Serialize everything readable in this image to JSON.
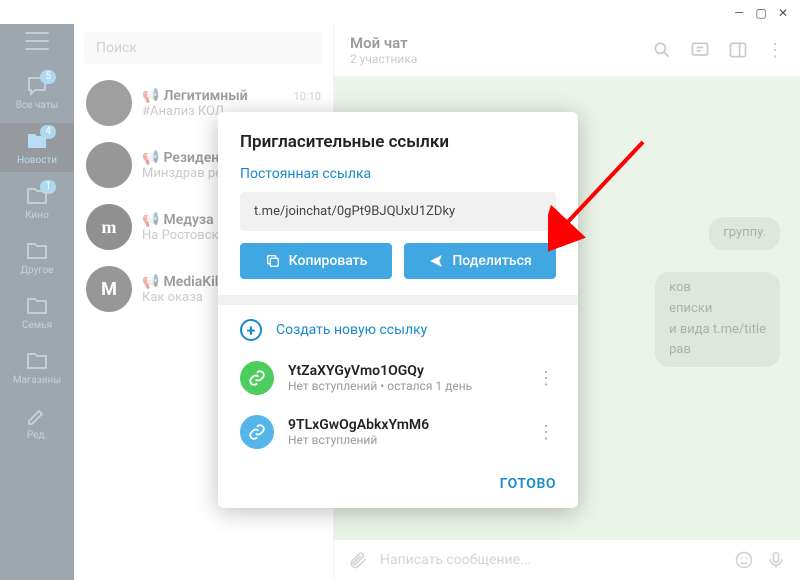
{
  "window": {
    "min": "—",
    "max": "▢",
    "close": "✕"
  },
  "rail": {
    "items": [
      {
        "label": "Все чаты",
        "badge": "5"
      },
      {
        "label": "Новости",
        "badge": "4"
      },
      {
        "label": "Кино",
        "badge": "1"
      },
      {
        "label": "Другое",
        "badge": ""
      },
      {
        "label": "Семья",
        "badge": ""
      },
      {
        "label": "Магазины",
        "badge": ""
      },
      {
        "label": "Ред.",
        "badge": ""
      }
    ]
  },
  "search": {
    "placeholder": "Поиск"
  },
  "chats": [
    {
      "name": "Легитимный",
      "preview": "#Анализ  КОЛ",
      "time": "10:10",
      "avatar": ""
    },
    {
      "name": "Резидент",
      "preview": "Минздрав ре",
      "time": "",
      "avatar": ""
    },
    {
      "name": "Медуза",
      "preview": "На Ростовско",
      "time": "",
      "avatar": "m"
    },
    {
      "name": "MediaKil",
      "preview": "Как оказа",
      "time": "",
      "avatar": "M"
    }
  ],
  "header": {
    "title": "Мой чат",
    "subtitle": "2 участника"
  },
  "system_messages": [
    "группу.",
    "ков",
    "еписки",
    "и вида t.me/title",
    "рав"
  ],
  "composer": {
    "placeholder": "Написать сообщение..."
  },
  "modal": {
    "title": "Пригласительные ссылки",
    "permanent_label": "Постоянная ссылка",
    "link": "t.me/joinchat/0gPt9BJQUxU1ZDky",
    "copy_label": "Копировать",
    "share_label": "Поделиться",
    "create_label": "Создать новую ссылку",
    "links": [
      {
        "name": "YtZaXYGyVmo1OGQy",
        "sub": "Нет вступлений • остался 1 день"
      },
      {
        "name": "9TLxGwOgAbkxYmM6",
        "sub": "Нет вступлений"
      }
    ],
    "done": "ГОТОВО"
  }
}
